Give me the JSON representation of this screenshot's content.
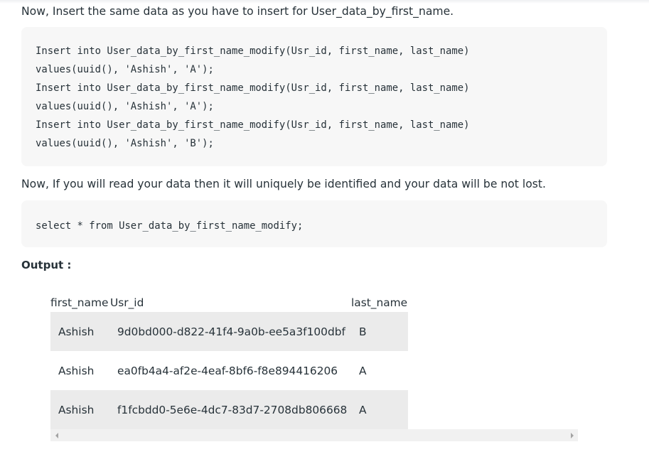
{
  "intro_text": "Now, Insert the same data as you have to insert for User_data_by_first_name.",
  "insert_code": [
    "Insert into User_data_by_first_name_modify(Usr_id, first_name, last_name)",
    "values(uuid(), 'Ashish', 'A');",
    "Insert into User_data_by_first_name_modify(Usr_id, first_name, last_name)",
    "values(uuid(), 'Ashish', 'A');",
    "Insert into User_data_by_first_name_modify(Usr_id, first_name, last_name)",
    "values(uuid(), 'Ashish', 'B');"
  ],
  "read_text": "Now, If you will read your data then it will uniquely be identified and your data will be not lost.",
  "select_code": "select * from User_data_by_first_name_modify;",
  "output_label": "Output :",
  "table": {
    "headers": [
      "first_name",
      "Usr_id",
      "last_name"
    ],
    "rows": [
      [
        "Ashish",
        "9d0bd000-d822-41f4-9a0b-ee5a3f100dbf",
        "B"
      ],
      [
        "Ashish",
        "ea0fb4a4-af2e-4eaf-8bf6-f8e894416206",
        "A"
      ],
      [
        "Ashish",
        "f1fcbdd0-5e6e-4dc7-83d7-2708db806668",
        "A"
      ]
    ]
  },
  "colors": {
    "text": "#273239",
    "code_background": "#f7f7f7",
    "row_shade": "#ebebeb",
    "scrollbar_track": "#f1f1f1",
    "scrollbar_arrow": "#a3a3a3"
  },
  "icons": {
    "scroll_left": "triangle-left",
    "scroll_right": "triangle-right"
  }
}
